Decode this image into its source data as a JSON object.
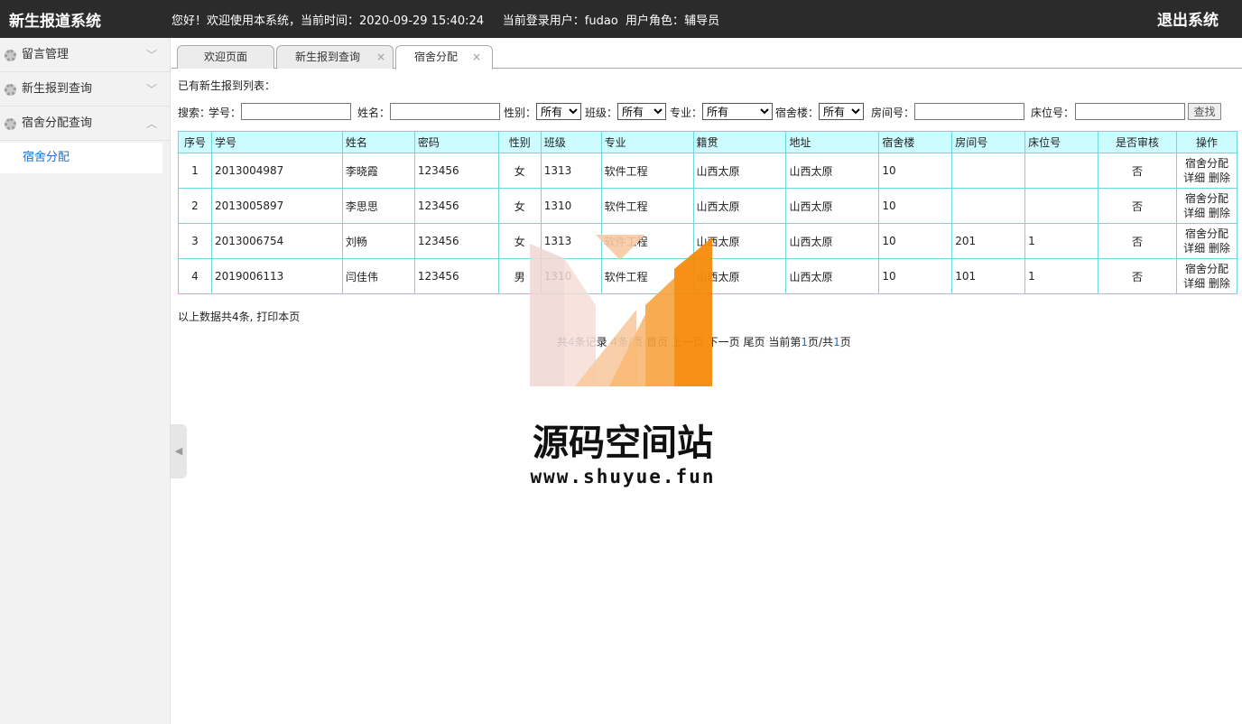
{
  "header": {
    "brand": "新生报道系统",
    "greeting": "您好！欢迎使用本系统，当前时间：",
    "datetime": "2020-09-29 15:40:24",
    "user_label": "当前登录用户：",
    "username": "fudao",
    "role_label": "用户角色：",
    "role": "辅导员",
    "logout": "退出系统"
  },
  "sidebar": {
    "items": [
      {
        "label": "留言管理",
        "chevron": "﹀"
      },
      {
        "label": "新生报到查询",
        "chevron": "﹀"
      },
      {
        "label": "宿舍分配查询",
        "chevron": "︿"
      }
    ],
    "subitem": "宿舍分配",
    "collapse_glyph": "◀"
  },
  "tabs": [
    {
      "label": "欢迎页面"
    },
    {
      "label": "新生报到查询",
      "close": "×"
    },
    {
      "label": "宿舍分配",
      "close": "×"
    }
  ],
  "list_title": "已有新生报到列表：",
  "search": {
    "prefix": "搜索：",
    "student_no": "学号：",
    "name": "姓名：",
    "gender": "性别：",
    "gender_value": "所有",
    "class": "班级：",
    "class_value": "所有",
    "major": "专业：",
    "major_value": "所有",
    "building": "宿舍楼：",
    "building_value": "所有",
    "room": "房间号：",
    "bed": "床位号：",
    "button": "查找"
  },
  "table": {
    "headers": [
      "序号",
      "学号",
      "姓名",
      "密码",
      "性别",
      "班级",
      "专业",
      "籍贯",
      "地址",
      "宿舍楼",
      "房间号",
      "床位号",
      "是否审核",
      "操作"
    ],
    "rows": [
      [
        "1",
        "2013004987",
        "李晓霞",
        "123456",
        "女",
        "1313",
        "软件工程",
        "山西太原",
        "山西太原",
        "10",
        "",
        "",
        "否"
      ],
      [
        "2",
        "2013005897",
        "李思思",
        "123456",
        "女",
        "1310",
        "软件工程",
        "山西太原",
        "山西太原",
        "10",
        "",
        "",
        "否"
      ],
      [
        "3",
        "2013006754",
        "刘畅",
        "123456",
        "女",
        "1313",
        "软件工程",
        "山西太原",
        "山西太原",
        "10",
        "201",
        "1",
        "否"
      ],
      [
        "4",
        "2019006113",
        "闫佳伟",
        "123456",
        "男",
        "1310",
        "软件工程",
        "山西太原",
        "山西太原",
        "10",
        "101",
        "1",
        "否"
      ]
    ],
    "ops": {
      "assign": "宿舍分配",
      "detail": "详细",
      "delete": "删除"
    }
  },
  "summary": {
    "text": "以上数据共4条,",
    "print": "打印本页"
  },
  "pager": {
    "total_prefix": "共",
    "total": "4",
    "records_per": "条记录 4条/页",
    "first": "首页",
    "prev": "上一页",
    "next": "下一页",
    "last": "尾页",
    "current_prefix": "当前第",
    "current": "1",
    "of": "页/共",
    "pages": "1",
    "suffix": "页"
  },
  "watermark": {
    "text": "源码空间站",
    "url": "www.shuyue.fun"
  }
}
